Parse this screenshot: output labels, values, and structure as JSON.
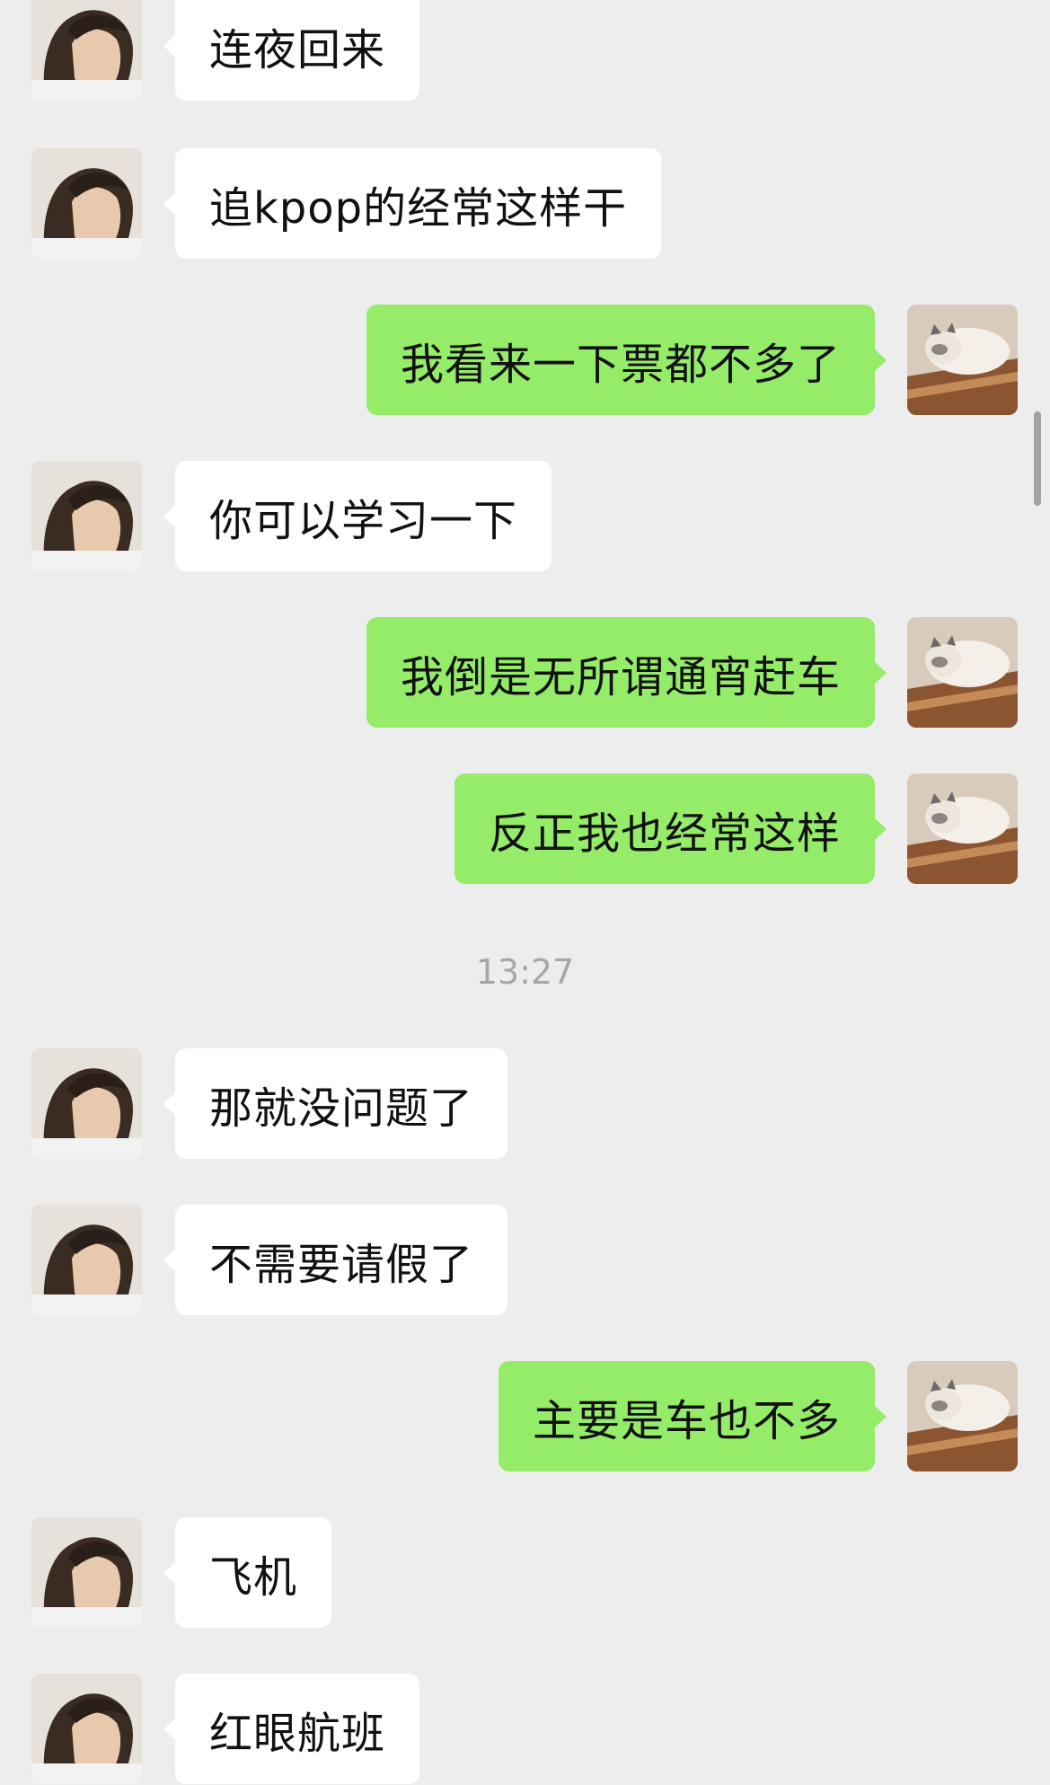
{
  "contact_avatar_icon": "person-avatar-icon",
  "self_avatar_icon": "cat-avatar-icon",
  "colors": {
    "background": "#ededed",
    "incoming_bubble": "#ffffff",
    "outgoing_bubble": "#95ec69",
    "timestamp_text": "#a6a6a6"
  },
  "messages": [
    {
      "side": "left",
      "text": "连夜回来"
    },
    {
      "side": "left",
      "text": "追kpop的经常这样干"
    },
    {
      "side": "right",
      "text": "我看来一下票都不多了"
    },
    {
      "side": "left",
      "text": "你可以学习一下"
    },
    {
      "side": "right",
      "text": "我倒是无所谓通宵赶车"
    },
    {
      "side": "right",
      "text": "反正我也经常这样"
    },
    {
      "side": "left",
      "text": "那就没问题了"
    },
    {
      "side": "left",
      "text": "不需要请假了"
    },
    {
      "side": "right",
      "text": "主要是车也不多"
    },
    {
      "side": "left",
      "text": "飞机"
    },
    {
      "side": "left",
      "text": "红眼航班"
    }
  ],
  "timestamp": "13:27"
}
